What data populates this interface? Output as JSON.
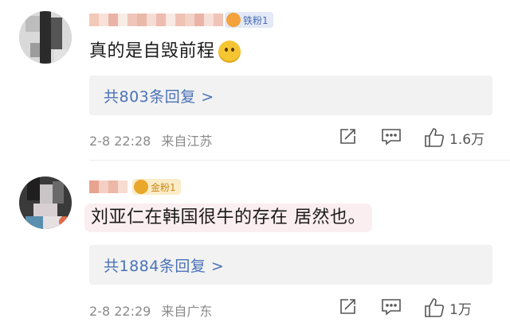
{
  "comments": [
    {
      "badge": {
        "label": "铁粉1",
        "icon": "fan-badge-icon"
      },
      "text": "真的是自毁前程",
      "emoji": "smiling-face-emoji",
      "reply_link": "共803条回复 >",
      "date": "2-8 22:28",
      "location": "来自江苏",
      "likes": "1.6万"
    },
    {
      "badge": {
        "label": "金粉1",
        "icon": "crown-badge-icon"
      },
      "text": "刘亚仁在韩国很牛的存在 居然也。",
      "reply_link": "共1884条回复 >",
      "date": "2-8 22:29",
      "location": "来自广东",
      "likes": "1万"
    }
  ],
  "colors": {
    "link": "#4a72b8",
    "meta_text": "#8a8a8a",
    "reply_bg": "#f2f2f2",
    "iron_badge_bg": "#e3e9f6",
    "gold_badge_bg": "#fbecc8",
    "highlight_bg": "#fbeef0"
  },
  "icons": [
    "share-icon",
    "comment-icon",
    "like-icon"
  ]
}
